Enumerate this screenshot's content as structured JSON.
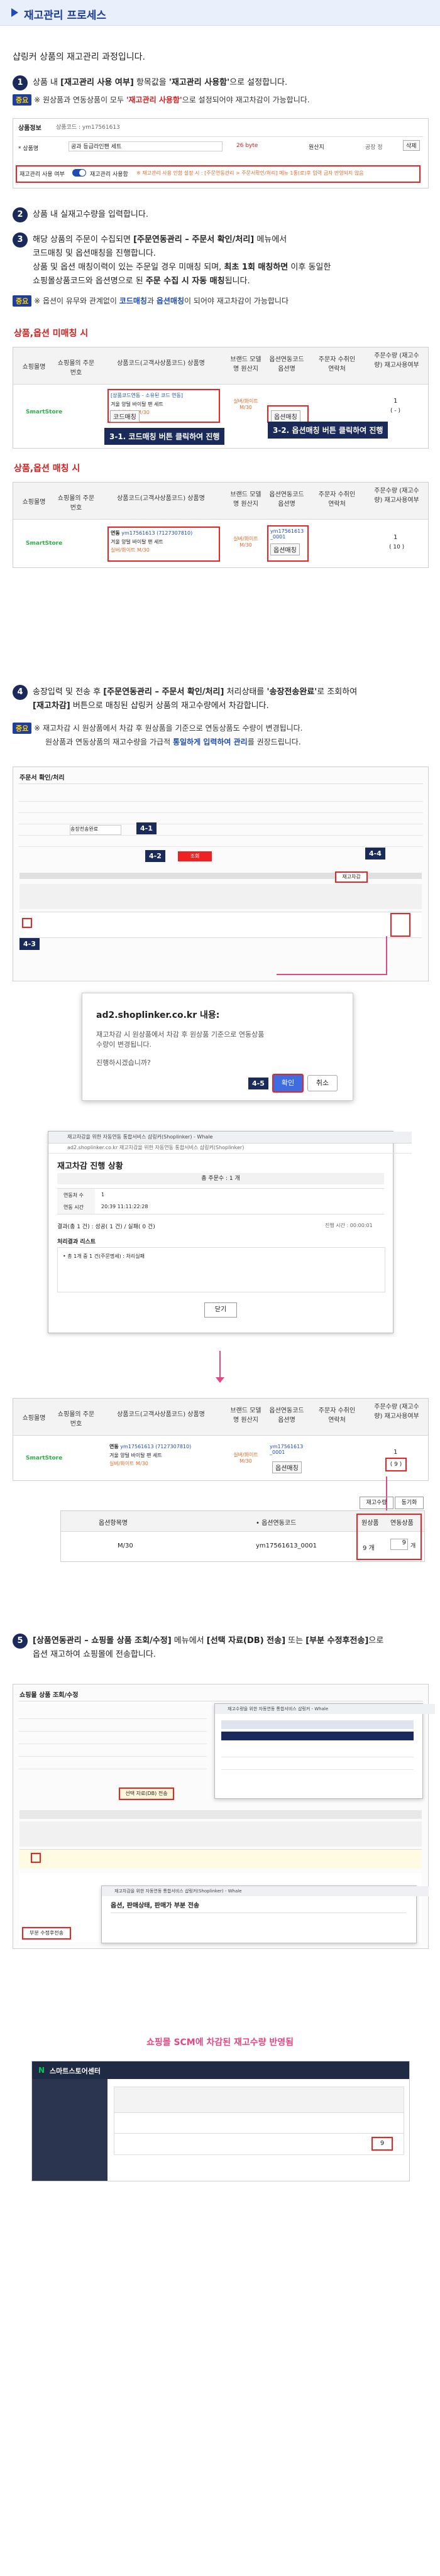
{
  "header": {
    "title": "재고관리 프로세스"
  },
  "intro": "샵링커 상품의 재고관리 과정입니다.",
  "step1": {
    "num": "1",
    "text_pre": "상품 내 ",
    "text_field": "[재고관리 사용 여부]",
    "text_mid": " 항목값을 ",
    "text_value": "'재고관리 사용함'",
    "text_post": "으로 설정합니다.",
    "tip_badge": "중요",
    "tip_pre": "※ 원상품과 연동상품이 모두 ",
    "tip_red": "'재고관리 사용함'",
    "tip_post": "으로 설정되어야 재고차감이 가능합니다.",
    "shot": {
      "status_label": "상품정보",
      "code_label": "상품코드 : ym17561613",
      "name_value": "공과 등급라인팬 세트",
      "name_red": "26 byte",
      "ori_name_label": "* 상품명",
      "place_label": "원산지",
      "origin_label": "공장 정",
      "stock_label": "재고관리 사용 여부",
      "stock_value": "재고관리 사용함",
      "stock_note": "※ 재고관리 사용 안함 설정 시 : [주문연동관리 > 주문서확인/처리] 메뉴 1통(로)후 입력 금자 반영되지 않음",
      "btn_label": "삭제"
    }
  },
  "step2": {
    "num": "2",
    "text": "상품 내 실재고수량을 입력합니다."
  },
  "step3": {
    "num": "3",
    "line1_pre": "해당 상품의 주문이 수집되면 ",
    "line1_bold": "[주문연동관리 – 주문서 확인/처리]",
    "line1_post": " 메뉴에서",
    "line2": "코드매칭 및 옵션매칭을 진행합니다.",
    "line3_pre": "상품 및 옵션 매칭이력이 있는 주문일 경우 미매칭 되며, ",
    "line3_bold": "최초 1회 매칭하면",
    "line3_post": " 이후 동일한",
    "line4_pre": "쇼핑몰상품코드와 옵션명으로 된 ",
    "line4_bold": "주문 수집 시 자동 매칭",
    "line4_post": "됩니다.",
    "tip_badge": "중요",
    "tip_pre": "※ 옵션이 유무와 관계없이 ",
    "tip_blue1": "코드매칭",
    "tip_mid": "과 ",
    "tip_blue2": "옵션매칭",
    "tip_post": "이 되어야 재고차감이 가능합니다"
  },
  "section_unmatched": "상품,옵션 미매칭 시",
  "section_matched": "상품,옵션 매칭 시",
  "table_cols": {
    "c1": "쇼핑몰명",
    "c2": "쇼핑몰의 주문번호",
    "c3": "상품코드(고객사상품코드) 상품명",
    "c4": "브랜드 모델명 원산지",
    "c5": "옵션연동코드 옵션명",
    "c6": "주문자 수취인 연락처",
    "c7": "주문수량 (재고수량) 재고사용여부"
  },
  "table_unmatched": {
    "shop": "SmartStore",
    "code_link": "[상품코드연동 - 소유된 코드 연동]",
    "product": "겨울 양털 바이탈 팬 세트",
    "option": "실버/화이트 M/30",
    "btn1": "코드매칭",
    "btn2": "옵션매칭",
    "qty": "1",
    "qty2": "( - )",
    "tag1": "3-1. 코드매칭 버튼 클릭하여 진행",
    "tag2": "3-2. 옵션매칭 버튼 클릭하여 진행"
  },
  "table_matched": {
    "shop": "SmartStore",
    "status": "연동",
    "code": "ym17561613 (7127307810)",
    "product": "겨울 양털 바이탈 팬 세트",
    "option": "실버/화이트 M/30",
    "opt_code": "ym17561613 _0001",
    "btn": "옵션매칭",
    "qty": "1",
    "qty2": "( 10 )"
  },
  "step4": {
    "num": "4",
    "line1_pre": "송장입력 및 전송 후 ",
    "line1_bold": "[주문연동관리 – 주문서 확인/처리]",
    "line1_mid": " 처리상태를 ",
    "line1_bold2": "'송장전송완료'",
    "line1_post": "로 조회하여",
    "line2_bold": "[재고차감]",
    "line2_post": " 버튼으로 매칭된 샵링커 상품의 재고수량에서 차감합니다.",
    "tip_badge": "중요",
    "tip_line1": "※ 재고차감 시 원상품에서 차감 후 원상품을 기준으로 연동상품도 수량이 변경됩니다.",
    "tip_line2_pre": "원상품과 연동상품의 재고수량을 가급적 ",
    "tip_line2_blue": "통일하게 입력하여 관리",
    "tip_line2_post": "를 권장드립니다.",
    "tags": [
      "4-1",
      "4-2",
      "4-3",
      "4-4",
      "4-5"
    ],
    "shot_title": "주문서 확인/처리",
    "status_value": "송장전송완료",
    "stock_btn": "재고차감"
  },
  "dialog": {
    "title": "ad2.shoplinker.co.kr 내용:",
    "body": "재고차감 시 원상품에서 차감 후 원상품 기준으로 연동상품 수량이 변경됩니다.",
    "question": "진행하시겠습니까?",
    "ok": "확인",
    "cancel": "취소"
  },
  "popup": {
    "window_title": "재고차감을 위한 자동연동 통합서비스 샵링커(Shoplinker) - Whale",
    "url": "ad2.shoplinker.co.kr 재고차감을 위한 자동연동 통합서비스 샵링커(Shoplinker)",
    "heading": "재고차감 진행 상황",
    "progress": "총 주문수 : 1 개",
    "row1_label": "연동처 수",
    "row1_value": "1",
    "row2_label": "연동 시간",
    "row2_value": "20:39 11:11:22:28",
    "summary": "결과(총 1 건) : 성공( 1 건) / 실패( 0 건)",
    "time": "진행 시간 : 00:00:01",
    "fail_title": "처리결과 리스트",
    "fail_row": "• 총 1개 중 1 건(주문명세) : 처리실패",
    "close": "닫기"
  },
  "table_after": {
    "shop": "SmartStore",
    "status": "연동",
    "code": "ym17561613 (7127307810)",
    "product": "겨울 양털 바이탈 팬 세트",
    "option": "실버/화이트 M/30",
    "opt_code": "ym17561613 _0001",
    "btn": "옵션매칭",
    "qty": "1",
    "qty2": "( 9 )"
  },
  "stock_box": {
    "btn1": "재고수량",
    "btn2": "동기화",
    "col_opt": "옵션항목명",
    "col_code": "• 옵션연동코드",
    "col_stock": "원상품",
    "col_linked": "연동상품",
    "row_opt": "M/30",
    "row_code": "ym17561613_0001",
    "row_stock": "9 개",
    "row_linked": "9",
    "row_linked_unit": "개"
  },
  "step5": {
    "num": "5",
    "line1_bold": "[상품연동관리 – 쇼핑몰 상품 조회/수정]",
    "line1_mid": " 메뉴에서 ",
    "line1_bold2": "[선택 자료(DB) 전송]",
    "line1_mid2": " 또는 ",
    "line1_bold3": "[부분 수정후전송]",
    "line1_post": "으로",
    "line2": "옵션 재고하여 쇼핑몰에 전송합니다.",
    "shot_title": "쇼핑몰 상품 조회/수정",
    "send_btn": "선택 자료(DB) 전송",
    "partial_btn": "부분 수정후전송",
    "popup_title": "재고수량을 위한 자동연동 통합서비스 샵링커 - Whale",
    "popup2_title": "재고차감을 위한 자동연동 통합서비스 샵링커(Shoplinker) - Whale",
    "popup2_heading": "옵션, 판매상태, 판매가 부분 전송",
    "result_text": "쇼핑몰 SCM에 차감된 재고수량 반영됨",
    "scm_title": "스마트스토어센터",
    "scm_value": "9"
  },
  "colors": {
    "navy": "#1a2a5a",
    "blue": "#1f4bb7",
    "red": "#e22222",
    "pink": "#e64783"
  }
}
